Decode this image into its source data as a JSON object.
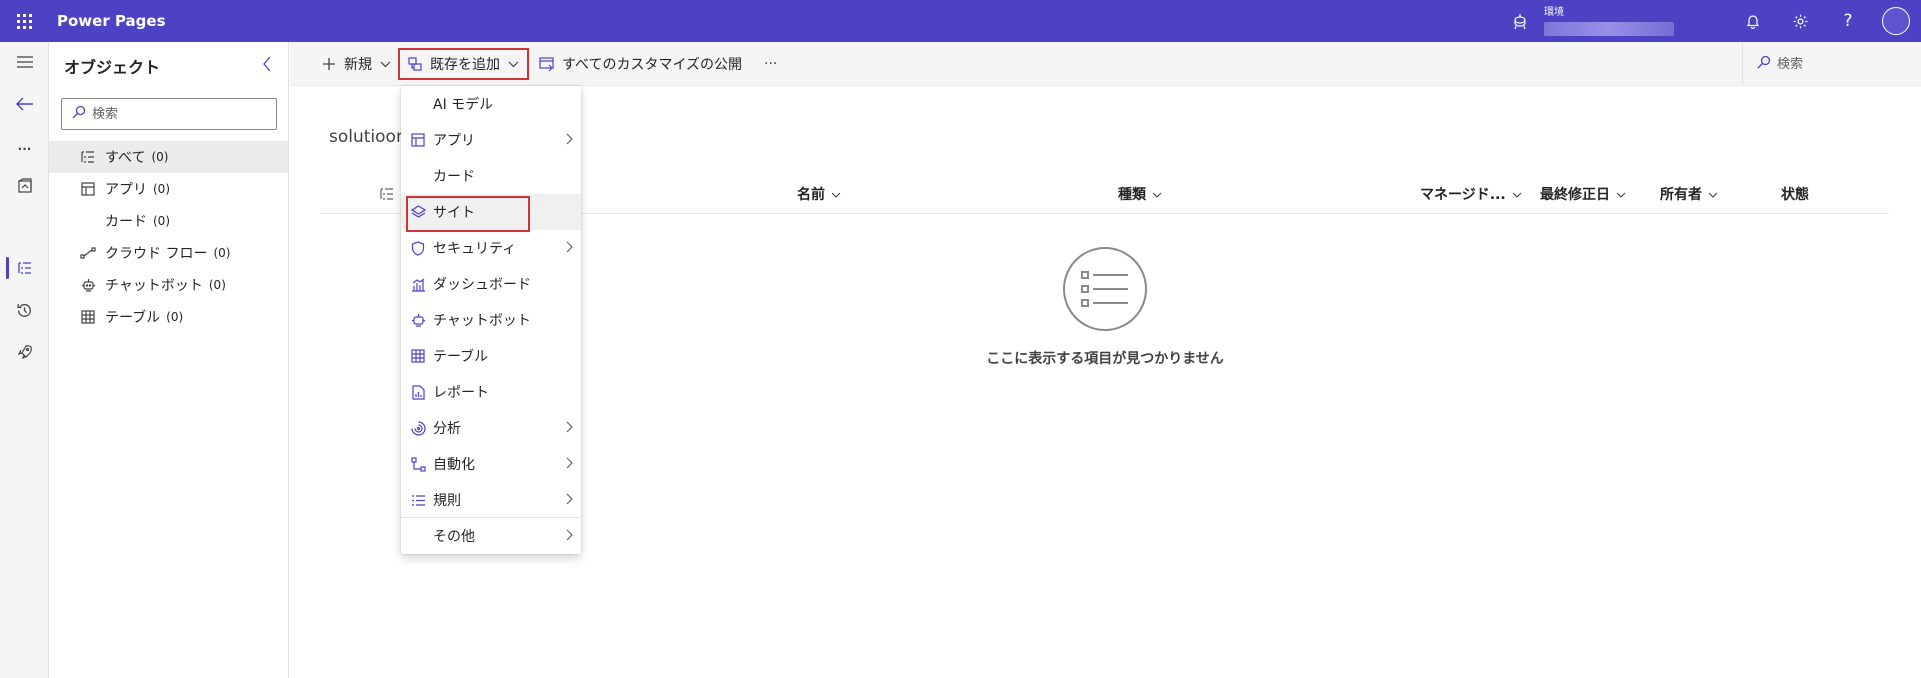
{
  "topbar": {
    "app_title": "Power Pages",
    "environment_label": "環境",
    "bg_color": "#4b43c4",
    "icons": [
      "waffle-icon",
      "environment-icon",
      "bell-icon",
      "gear-icon",
      "help-icon",
      "avatar"
    ]
  },
  "rail": {
    "more_label": "...",
    "icons": [
      "hamburger-icon",
      "back-arrow-icon",
      "more-icon",
      "pages-icon",
      "objects-icon",
      "history-icon",
      "rocket-icon"
    ]
  },
  "objects": {
    "title": "オブジェクト",
    "search_placeholder": "検索",
    "items": [
      {
        "label": "すべて",
        "count": "(0)"
      },
      {
        "label": "アプリ",
        "count": "(0)"
      },
      {
        "label": "カード",
        "count": "(0)"
      },
      {
        "label": "クラウド フロー",
        "count": "(0)"
      },
      {
        "label": "チャットボット",
        "count": "(0)"
      },
      {
        "label": "テーブル",
        "count": "(0)"
      }
    ]
  },
  "commandbar": {
    "new_label": "新規",
    "add_existing_label": "既存を追加",
    "publish_label": "すべてのカスタマイズの公開",
    "more_label": "···",
    "search_placeholder": "検索"
  },
  "main": {
    "solution_title": "solutioon",
    "columns": [
      "名前",
      "種類",
      "マネージド...",
      "最終修正日",
      "所有者",
      "状態"
    ],
    "empty_message": "ここに表示する項目が見つかりません"
  },
  "menu": {
    "items": [
      {
        "label": "AI モデル"
      },
      {
        "label": "アプリ"
      },
      {
        "label": "カード"
      },
      {
        "label": "サイト"
      },
      {
        "label": "セキュリティ"
      },
      {
        "label": "ダッシュボード"
      },
      {
        "label": "チャットボット"
      },
      {
        "label": "テーブル"
      },
      {
        "label": "レポート"
      },
      {
        "label": "分析"
      },
      {
        "label": "自動化"
      },
      {
        "label": "規則"
      },
      {
        "label": "その他"
      }
    ],
    "highlight_color": "#d13438"
  }
}
